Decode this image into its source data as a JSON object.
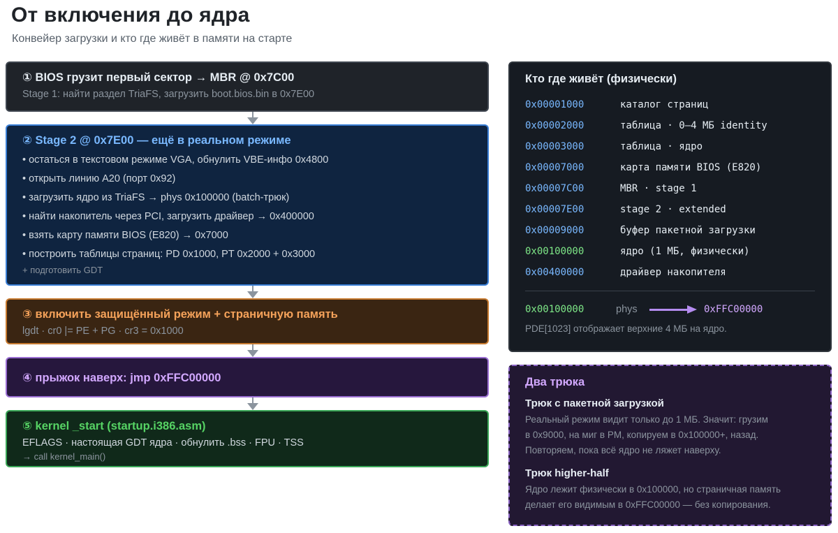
{
  "header": {
    "title": "От включения до ядра",
    "subtitle": "Конвейер загрузки и кто где живёт в памяти на старте"
  },
  "stages": [
    {
      "title": "① BIOS грузит первый сектор → MBR @ 0x7C00",
      "lines": [
        "Stage 1: найти раздел TriaFS, загрузить boot.bios.bin в 0x7E00"
      ]
    },
    {
      "title": "② Stage 2 @ 0x7E00 — ещё в реальном режиме",
      "lines": [
        "• остаться в текстовом режиме VGA, обнулить VBE-инфо 0x4800",
        "• открыть линию A20 (порт 0x92)",
        "• загрузить ядро из TriaFS → phys 0x100000 (batch-трюк)",
        "• найти накопитель через PCI, загрузить драйвер → 0x400000",
        "• взять карту памяти BIOS (E820) → 0x7000",
        "• построить таблицы страниц: PD 0x1000, PT 0x2000 + 0x3000"
      ],
      "footnote": "+ подготовить GDT"
    },
    {
      "title": "③ включить защищённый режим + страничную память",
      "lines": [
        "lgdt · cr0 |= PE + PG · cr3 = 0x1000"
      ]
    },
    {
      "title": "④ прыжок наверх: jmp 0xFFC00000",
      "lines": []
    },
    {
      "title": "⑤ kernel _start (startup.i386.asm)",
      "lines": [
        "EFLAGS · настоящая GDT ядра · обнулить .bss · FPU · TSS"
      ],
      "footnote": "→ call kernel_main()"
    }
  ],
  "memory_map": {
    "title": "Кто где живёт (физически)",
    "rows": [
      {
        "addr": "0x00001000",
        "label": "каталог страниц"
      },
      {
        "addr": "0x00002000",
        "label": "таблица · 0–4 МБ identity"
      },
      {
        "addr": "0x00003000",
        "label": "таблица · ядро"
      },
      {
        "addr": "0x00007000",
        "label": "карта памяти BIOS (E820)"
      },
      {
        "addr": "0x00007C00",
        "label": "MBR · stage 1"
      },
      {
        "addr": "0x00007E00",
        "label": "stage 2 · extended"
      },
      {
        "addr": "0x00009000",
        "label": "буфер пакетной загрузки"
      },
      {
        "addr": "0x00100000",
        "label": "ядро (1 МБ, физически)"
      },
      {
        "addr": "0x00400000",
        "label": "драйвер накопителя"
      }
    ],
    "mapping": {
      "phys_addr": "0x00100000",
      "phys_word": "phys",
      "virt_addr": "0xFFC00000",
      "note": "PDE[1023] отображает верхние 4 МБ на ядро."
    }
  },
  "tricks": {
    "title": "Два трюка",
    "items": [
      {
        "title": "Трюк с пакетной загрузкой",
        "lines": [
          "Реальный режим видит только до 1 МБ. Значит: грузим",
          "в 0x9000, на миг в PM, копируем в 0x100000+, назад.",
          "Повторяем, пока всё ядро не ляжет наверху."
        ]
      },
      {
        "title": "Трюк higher-half",
        "lines": [
          "Ядро лежит физически в 0x100000, но страничная память",
          "делает его видимым в 0xFFC00000 — без копирования."
        ]
      }
    ]
  },
  "colors": {
    "stage1": "#1f2329",
    "stage2": "#0f2440",
    "stage3": "#3a2512",
    "stage4": "#26173d",
    "stage5": "#10291a",
    "accent_blue": "#79b8ff",
    "accent_green": "#7ee787",
    "accent_purple": "#d2a8ff",
    "accent_orange": "#f5a25a"
  }
}
